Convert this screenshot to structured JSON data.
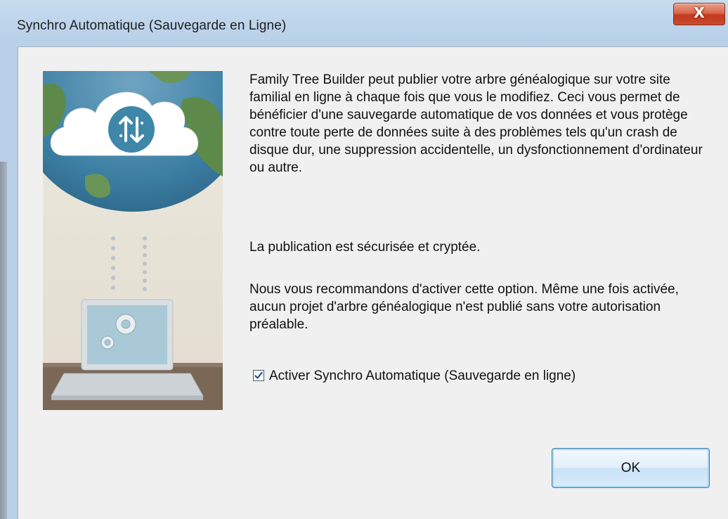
{
  "window": {
    "title": "Synchro Automatique (Sauvegarde en Ligne)",
    "close_glyph": "X"
  },
  "content": {
    "paragraph1": "Family Tree Builder peut publier votre arbre généalogique sur votre site familial en ligne à chaque fois que vous le modifiez. Ceci vous permet de bénéficier d'une sauvegarde automatique de vos données et vous protège contre toute perte de données suite à des problèmes tels qu'un crash de disque dur, une suppression accidentelle, un dysfonctionnement d'ordinateur ou autre.",
    "paragraph2": "La publication est sécurisée et cryptée.",
    "paragraph3": "Nous vous recommandons d'activer cette option. Même une fois activée, aucun projet d'arbre généalogique n'est publié sans votre autorisation préalable."
  },
  "checkbox": {
    "label": "Activer Synchro Automatique (Sauvegarde en ligne)",
    "checked": true
  },
  "buttons": {
    "ok_label": "OK"
  },
  "illustration": {
    "icons": [
      "cloud-sync-icon",
      "laptop-icon",
      "gear-icon"
    ]
  }
}
